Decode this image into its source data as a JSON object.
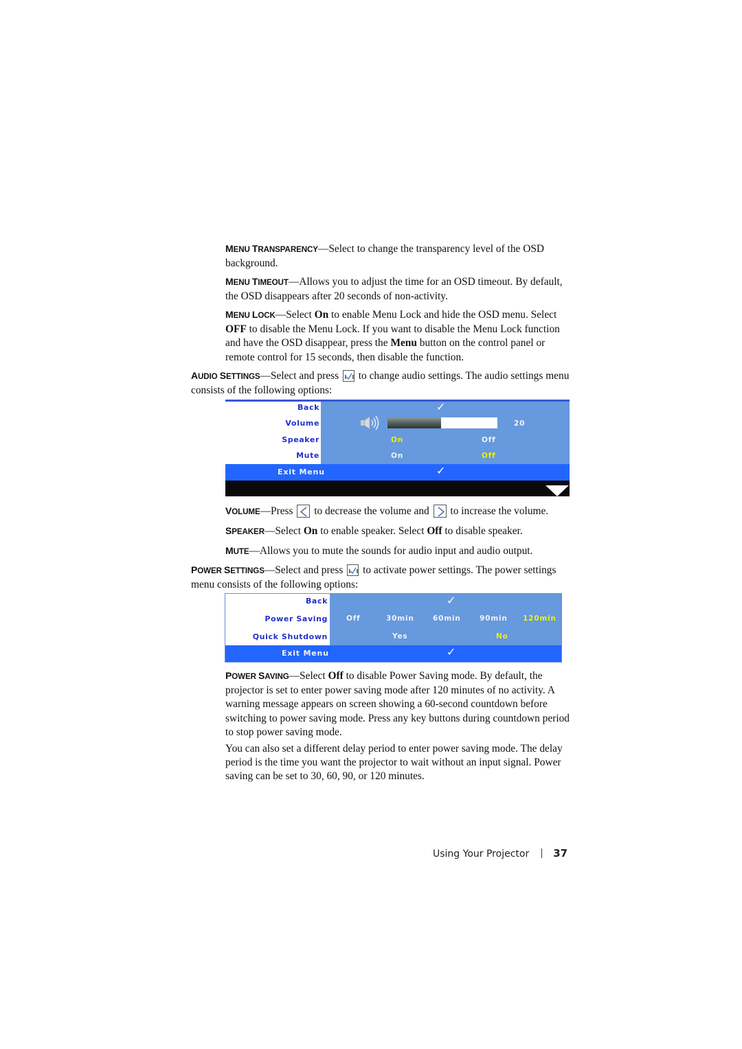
{
  "sections": {
    "menu_transparency": {
      "term_cap1": "M",
      "term_rest1": "enu ",
      "term_cap2": "T",
      "term_rest2": "ransparency",
      "text": "—Select to change the transparency level of the OSD background."
    },
    "menu_timeout": {
      "term_cap1": "M",
      "term_rest1": "enu ",
      "term_cap2": "T",
      "term_rest2": "imeout",
      "text": "—Allows you to adjust the time for an OSD timeout. By default, the OSD disappears after 20 seconds of non-activity."
    },
    "menu_lock": {
      "term_cap1": "M",
      "term_rest1": "enu ",
      "term_cap2": "L",
      "term_rest2": "ock",
      "t1": "—Select ",
      "b1": "On",
      "t2": " to enable Menu Lock and hide the OSD menu. Select ",
      "b2": "OFF",
      "t3": " to disable the Menu Lock. If you want to disable the Menu Lock function and have the OSD disappear, press the ",
      "b3": "Menu",
      "t4": " button on the control panel or remote control for 15 seconds, then disable the function."
    },
    "audio_settings": {
      "term_cap1": "A",
      "term_rest1": "udio ",
      "term_cap2": "S",
      "term_rest2": "ettings",
      "t1": "—Select and press ",
      "key_icon": "check-key-icon",
      "t2": " to change audio settings. The audio settings menu consists of the following options:"
    },
    "volume": {
      "term_cap1": "V",
      "term_rest1": "olume",
      "t1": "—Press ",
      "key_left": "left-arrow-key-icon",
      "t2": " to decrease the volume and ",
      "key_right": "right-arrow-key-icon",
      "t3": " to increase the volume."
    },
    "speaker": {
      "term_cap1": "S",
      "term_rest1": "peaker",
      "t1": "—Select ",
      "b1": "On",
      "t2": " to enable speaker. Select ",
      "b2": "Off",
      "t3": " to disable speaker."
    },
    "mute": {
      "term_cap1": "M",
      "term_rest1": "ute",
      "text": "—Allows you to mute the sounds for audio input and audio output."
    },
    "power_settings": {
      "term_cap1": "P",
      "term_rest1": "ower ",
      "term_cap2": "S",
      "term_rest2": "ettings",
      "t1": "—Select and press ",
      "key_icon": "check-key-icon",
      "t2": " to activate power settings. The power settings menu consists of the following options:"
    },
    "power_saving": {
      "term_cap1": "P",
      "term_rest1": "ower ",
      "term_cap2": "S",
      "term_rest2": "aving",
      "t1": "—Select ",
      "b1": "Off",
      "t2": " to disable Power Saving mode. By default, the projector is set to enter power saving mode after 120 minutes of no activity. A warning message appears on screen showing a 60-second countdown before switching to power saving mode. Press any key buttons during countdown period to stop power saving mode."
    },
    "delay_note": {
      "text": "You can also set a different delay period to enter power saving mode. The delay period is the time you want the projector to wait without an input signal. Power saving can be set to 30, 60, 90, or 120 minutes."
    }
  },
  "audio_menu": {
    "rows": [
      {
        "label": "Back"
      },
      {
        "label": "Volume",
        "value": "20",
        "level": 0.49
      },
      {
        "label": "Speaker",
        "options": [
          "On",
          "Off"
        ],
        "selected": "On"
      },
      {
        "label": "Mute",
        "options": [
          "On",
          "Off"
        ],
        "selected": "Off"
      }
    ],
    "exit_label": "Exit Menu",
    "check_glyph": "✓",
    "colors": {
      "panel": "#6699dd",
      "exit": "#2266ff",
      "label": "#2430c8",
      "selected": "#f2f000",
      "bottom_bar": "#0a0a0a"
    }
  },
  "power_menu": {
    "rows": [
      {
        "label": "Back"
      },
      {
        "label": "Power Saving",
        "options": [
          "Off",
          "30min",
          "60min",
          "90min",
          "120min"
        ],
        "selected": "120min"
      },
      {
        "label": "Quick Shutdown",
        "options": [
          "Yes",
          "No"
        ],
        "selected": "No"
      }
    ],
    "exit_label": "Exit Menu",
    "check_glyph": "✓"
  },
  "footer": {
    "section_title": "Using Your Projector",
    "page_number": "37"
  }
}
